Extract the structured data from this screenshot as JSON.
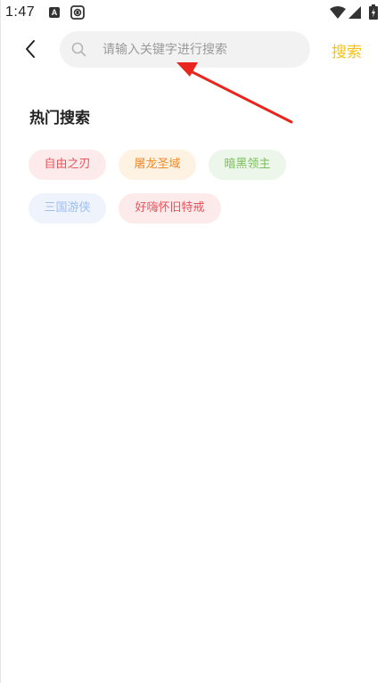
{
  "status_bar": {
    "time": "1:47",
    "notification_letter": "A"
  },
  "search": {
    "placeholder": "请输入关键字进行搜索",
    "value": "",
    "submit_label": "搜索"
  },
  "hot_search": {
    "title": "热门搜索",
    "tags": [
      {
        "label": "自由之刃",
        "color": "#e8545a",
        "bg": "#fdebec"
      },
      {
        "label": "屠龙圣域",
        "color": "#f08a2b",
        "bg": "#fef3e3"
      },
      {
        "label": "暗黑领主",
        "color": "#79bf57",
        "bg": "#edf6ea"
      },
      {
        "label": "三国游侠",
        "color": "#9fbef0",
        "bg": "#eef3fc"
      },
      {
        "label": "好嗨怀旧特戒",
        "color": "#e8545a",
        "bg": "#fdebec"
      }
    ]
  },
  "colors": {
    "accent": "#f6c214",
    "arrow": "#e8251e"
  }
}
